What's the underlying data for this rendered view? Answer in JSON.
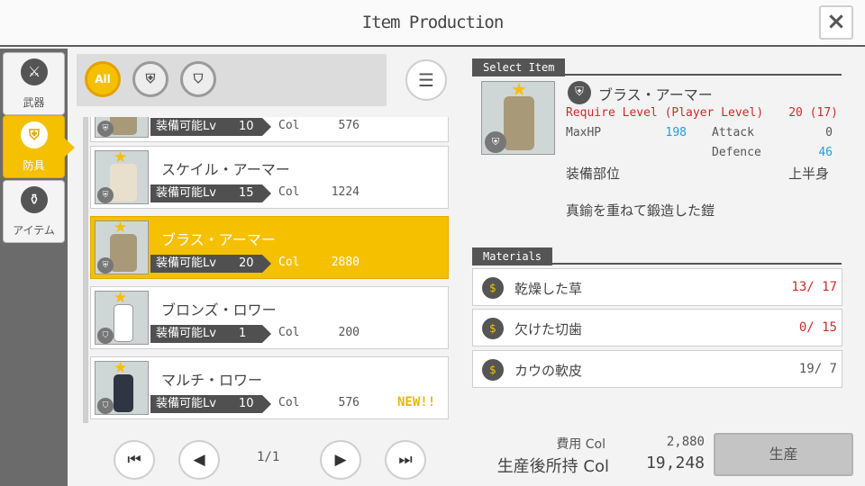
{
  "window": {
    "title": "Item Production",
    "close_icon": "×"
  },
  "categories": [
    {
      "label": "武器",
      "icon": "sword-icon",
      "glyph": "⚔",
      "selected": false
    },
    {
      "label": "防具",
      "icon": "armor-icon",
      "glyph": "⛨",
      "selected": true
    },
    {
      "label": "アイテム",
      "icon": "bottle-icon",
      "glyph": "⚱",
      "selected": false
    }
  ],
  "filters": [
    {
      "label": "All",
      "icon": "all-filter-icon",
      "selected": true
    },
    {
      "label": "",
      "icon": "armor-upper-filter-icon",
      "glyph": "⛨",
      "selected": false
    },
    {
      "label": "",
      "icon": "armor-lower-filter-icon",
      "glyph": "⛉",
      "selected": false
    }
  ],
  "sort_icon": "sort-icon",
  "list": {
    "level_label": "装備可能Lv",
    "col_label": "Col",
    "items": [
      {
        "name": "",
        "level": "10",
        "col": "576",
        "badge": "⛨",
        "is_new": false,
        "selected": false
      },
      {
        "name": "スケイル・アーマー",
        "level": "15",
        "col": "1224",
        "badge": "⛨",
        "is_new": false,
        "selected": false
      },
      {
        "name": "ブラス・アーマー",
        "level": "20",
        "col": "2880",
        "badge": "⛨",
        "is_new": false,
        "selected": true
      },
      {
        "name": "ブロンズ・ロワー",
        "level": "1",
        "col": "200",
        "badge": "⛉",
        "is_new": false,
        "selected": false
      },
      {
        "name": "マルチ・ロワー",
        "level": "10",
        "col": "576",
        "badge": "⛉",
        "is_new": true,
        "selected": false
      }
    ],
    "new_label": "NEW!!"
  },
  "pagination": {
    "indicator": "1/1",
    "first": "⏮",
    "prev": "◀",
    "next": "▶",
    "last": "⏭"
  },
  "select_item": {
    "header": "Select Item",
    "name": "ブラス・アーマー",
    "require_label": "Require Level (Player Level)",
    "require_value": "20 (17)",
    "maxhp_label": "MaxHP",
    "maxhp_value": "198",
    "attack_label": "Attack",
    "attack_value": "0",
    "defence_label": "Defence",
    "defence_value": "46",
    "part_label": "装備部位",
    "part_value": "上半身",
    "description": "真鍮を重ねて鍛造した鎧"
  },
  "materials": {
    "header": "Materials",
    "items": [
      {
        "name": "乾燥した草",
        "qty": "13/ 17",
        "insufficient": true
      },
      {
        "name": "欠けた切歯",
        "qty": "0/ 15",
        "insufficient": true
      },
      {
        "name": "カウの軟皮",
        "qty": "19/ 7",
        "insufficient": false
      }
    ]
  },
  "cost": {
    "fee_label": "費用 Col",
    "fee_value": "2,880",
    "after_label": "生産後所持 Col",
    "after_value": "19,248"
  },
  "produce_button": "生産",
  "colors": {
    "accent": "#f5c000",
    "dark": "#555555",
    "red": "#d12a2a",
    "blue": "#1ea0d8"
  }
}
